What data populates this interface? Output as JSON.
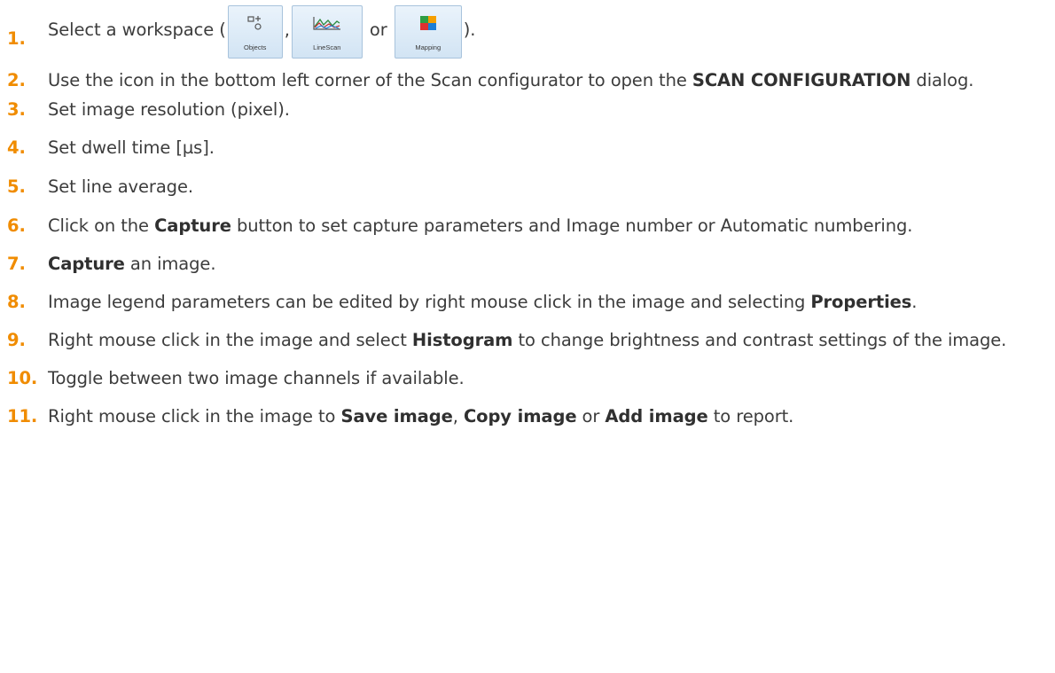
{
  "steps": [
    {
      "num": "1.",
      "text_before": "Select a workspace (",
      "workspace_objects": "Objects",
      "sep1": ",",
      "workspace_linescan": "LineScan",
      "sep2": " or ",
      "workspace_mapping": "Mapping",
      "text_after": ")."
    },
    {
      "num": "2.",
      "text": "Use the icon in the bottom left corner of the Scan configurator to open the ",
      "bold": "SCAN CONFIGURATION",
      "text_after": " dialog."
    },
    {
      "num": "3.",
      "text": "Set image resolution (pixel)."
    },
    {
      "num": "4.",
      "text": "Set dwell time [µs]."
    },
    {
      "num": "5.",
      "text": "Set line average."
    },
    {
      "num": "6.",
      "text_before": "Click on the ",
      "bold": "Capture",
      "text_after": " button to set capture parameters and Image number or Automatic numbering."
    },
    {
      "num": "7.",
      "bold": "Capture",
      "text_after": " an image."
    },
    {
      "num": "8.",
      "text_before": "Image legend parameters can be edited by right mouse click in the image and selecting ",
      "bold": "Properties",
      "text_after": "."
    },
    {
      "num": "9.",
      "text_before": "Right mouse click in the image and select ",
      "bold": "Histogram",
      "text_after": " to change brightness and contrast settings of the image."
    },
    {
      "num": "10.",
      "text": "Toggle between two image channels if available."
    },
    {
      "num": "11.",
      "text_before": "Right mouse click in the image to ",
      "bold1": "Save image",
      "sep1": ", ",
      "bold2": "Copy image",
      "sep2": " or ",
      "bold3": "Add image",
      "text_after": " to report."
    }
  ],
  "colors": {
    "number": "#f08c00",
    "text": "#3c3c3c",
    "button_bg": "#d2e4f4",
    "button_border": "#a8c3dc"
  },
  "icons": {
    "objects": "objects-workspace-icon",
    "linescan": "linescan-workspace-icon",
    "mapping": "mapping-workspace-icon"
  }
}
